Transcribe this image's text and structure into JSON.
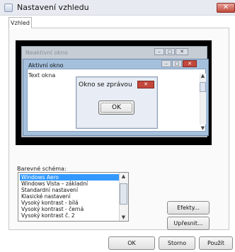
{
  "window": {
    "title": "Nastavení vzhledu",
    "close_glyph": "✕"
  },
  "tabs": [
    {
      "label": "Vzhled"
    }
  ],
  "preview": {
    "inactive_window_title": "Neaktivní okno",
    "active_window_title": "Aktivní okno",
    "window_text": "Text okna",
    "message_box_title": "Okno se zprávou",
    "message_ok_label": "OK",
    "minimize_glyph": "–",
    "maximize_glyph": "□",
    "close_glyph": "✕",
    "scroll_up_glyph": "▲",
    "scroll_down_glyph": "▼"
  },
  "color_scheme": {
    "label": "Barevné schéma:",
    "items": [
      "Windows Aero",
      "Windows Vista – základní",
      "Standardní nastavení",
      "Klasické nastavení",
      "Vysoký kontrast - bílá",
      "Vysoký kontrast - černá",
      "Vysoký kontrast č. 2"
    ],
    "selected_index": 0
  },
  "buttons": {
    "effects": "Efekty...",
    "advanced": "Upřesnit...",
    "ok": "OK",
    "cancel": "Storno",
    "apply": "Použít"
  },
  "colors": {
    "selection": "#3399ff",
    "active_title": "#a5c0dd",
    "close_button": "#c4473b"
  }
}
